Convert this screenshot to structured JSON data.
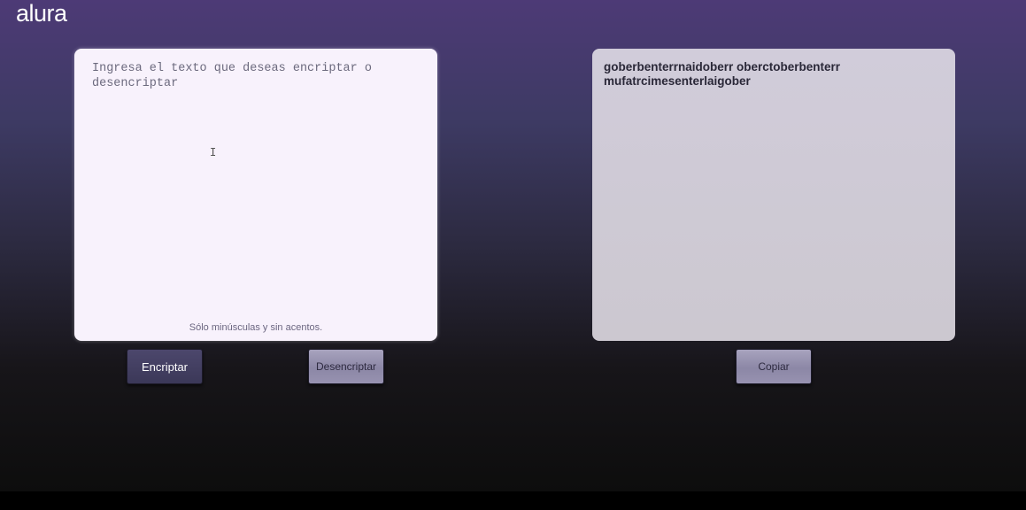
{
  "header": {
    "logo_text": "alura"
  },
  "input": {
    "placeholder": "Ingresa el texto que deseas encriptar o desencriptar",
    "value": "",
    "hint": "Sólo minúsculas y sin acentos."
  },
  "actions": {
    "encrypt_label": "Encriptar",
    "decrypt_label": "Desencriptar",
    "copy_label": "Copiar"
  },
  "output": {
    "text": "goberbenterrnaidoberr oberctoberbenterr mufatrcimesenterlaigober"
  },
  "colors": {
    "background_top": "#4d3a76",
    "background_bottom": "#0d0d0d",
    "input_card": "#f8f2fc",
    "output_card": "#cfcad6",
    "primary_button": "#453f63",
    "secondary_button": "#9792b0"
  }
}
